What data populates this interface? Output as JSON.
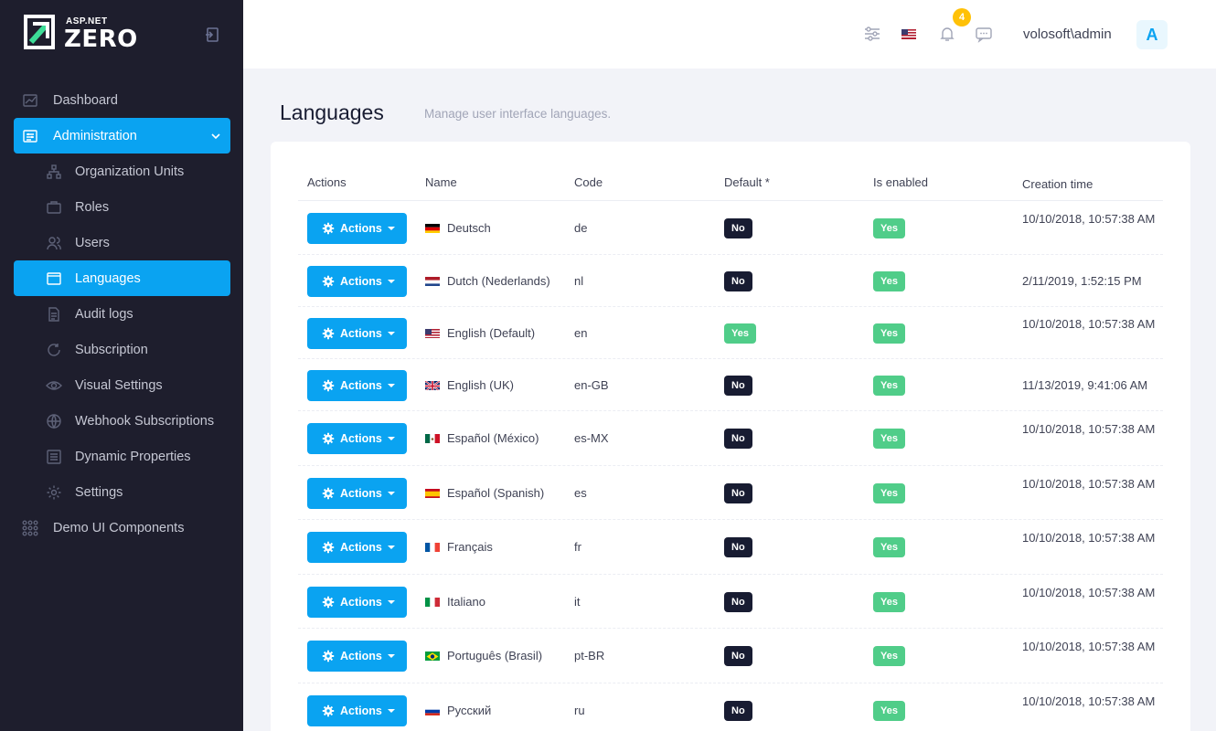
{
  "brand": {
    "top": "ASP.NET",
    "main": "ZERO"
  },
  "sidebar": {
    "items": [
      {
        "label": "Dashboard",
        "icon": "chart-icon",
        "sub": false,
        "active": false
      },
      {
        "label": "Administration",
        "icon": "admin-icon",
        "sub": false,
        "active": true,
        "expanded": true
      },
      {
        "label": "Organization Units",
        "icon": "org-tree-icon",
        "sub": true,
        "active": false
      },
      {
        "label": "Roles",
        "icon": "briefcase-icon",
        "sub": true,
        "active": false
      },
      {
        "label": "Users",
        "icon": "users-icon",
        "sub": true,
        "active": false
      },
      {
        "label": "Languages",
        "icon": "window-icon",
        "sub": true,
        "active": true
      },
      {
        "label": "Audit logs",
        "icon": "document-icon",
        "sub": true,
        "active": false
      },
      {
        "label": "Subscription",
        "icon": "refresh-icon",
        "sub": true,
        "active": false
      },
      {
        "label": "Visual Settings",
        "icon": "eye-icon",
        "sub": true,
        "active": false
      },
      {
        "label": "Webhook Subscriptions",
        "icon": "globe-icon",
        "sub": true,
        "active": false
      },
      {
        "label": "Dynamic Properties",
        "icon": "list-icon",
        "sub": true,
        "active": false
      },
      {
        "label": "Settings",
        "icon": "gear-icon",
        "sub": true,
        "active": false
      },
      {
        "label": "Demo UI Components",
        "icon": "grid-icon",
        "sub": false,
        "active": false
      }
    ]
  },
  "header": {
    "notification_count": "4",
    "username": "volosoft\\admin",
    "avatar_letter": "A"
  },
  "page": {
    "title": "Languages",
    "description": "Manage user interface languages."
  },
  "table": {
    "headers": {
      "actions": "Actions",
      "name": "Name",
      "code": "Code",
      "default": "Default *",
      "enabled": "Is enabled",
      "created": "Creation time"
    },
    "action_label": "Actions",
    "rows": [
      {
        "name": "Deutsch",
        "flag": "de",
        "code": "de",
        "default": "No",
        "enabled": "Yes",
        "created": "10/10/2018, 10:57:38 AM"
      },
      {
        "name": "Dutch (Nederlands)",
        "flag": "nl",
        "code": "nl",
        "default": "No",
        "enabled": "Yes",
        "created": "2/11/2019, 1:52:15 PM"
      },
      {
        "name": "English (Default)",
        "flag": "us",
        "code": "en",
        "default": "Yes",
        "enabled": "Yes",
        "created": "10/10/2018, 10:57:38 AM"
      },
      {
        "name": "English (UK)",
        "flag": "gb",
        "code": "en-GB",
        "default": "No",
        "enabled": "Yes",
        "created": "11/13/2019, 9:41:06 AM"
      },
      {
        "name": "Español (México)",
        "flag": "mx",
        "code": "es-MX",
        "default": "No",
        "enabled": "Yes",
        "created": "10/10/2018, 10:57:38 AM"
      },
      {
        "name": "Español (Spanish)",
        "flag": "es",
        "code": "es",
        "default": "No",
        "enabled": "Yes",
        "created": "10/10/2018, 10:57:38 AM"
      },
      {
        "name": "Français",
        "flag": "fr",
        "code": "fr",
        "default": "No",
        "enabled": "Yes",
        "created": "10/10/2018, 10:57:38 AM"
      },
      {
        "name": "Italiano",
        "flag": "it",
        "code": "it",
        "default": "No",
        "enabled": "Yes",
        "created": "10/10/2018, 10:57:38 AM"
      },
      {
        "name": "Português (Brasil)",
        "flag": "br",
        "code": "pt-BR",
        "default": "No",
        "enabled": "Yes",
        "created": "10/10/2018, 10:57:38 AM"
      },
      {
        "name": "Русский",
        "flag": "ru",
        "code": "ru",
        "default": "No",
        "enabled": "Yes",
        "created": "10/10/2018, 10:57:38 AM"
      }
    ]
  },
  "colors": {
    "sidebar_bg": "#1e1e2d",
    "accent": "#0aa3f1",
    "badge_yes": "#50cd89",
    "badge_no": "#181c32",
    "notification": "#ffc107"
  }
}
